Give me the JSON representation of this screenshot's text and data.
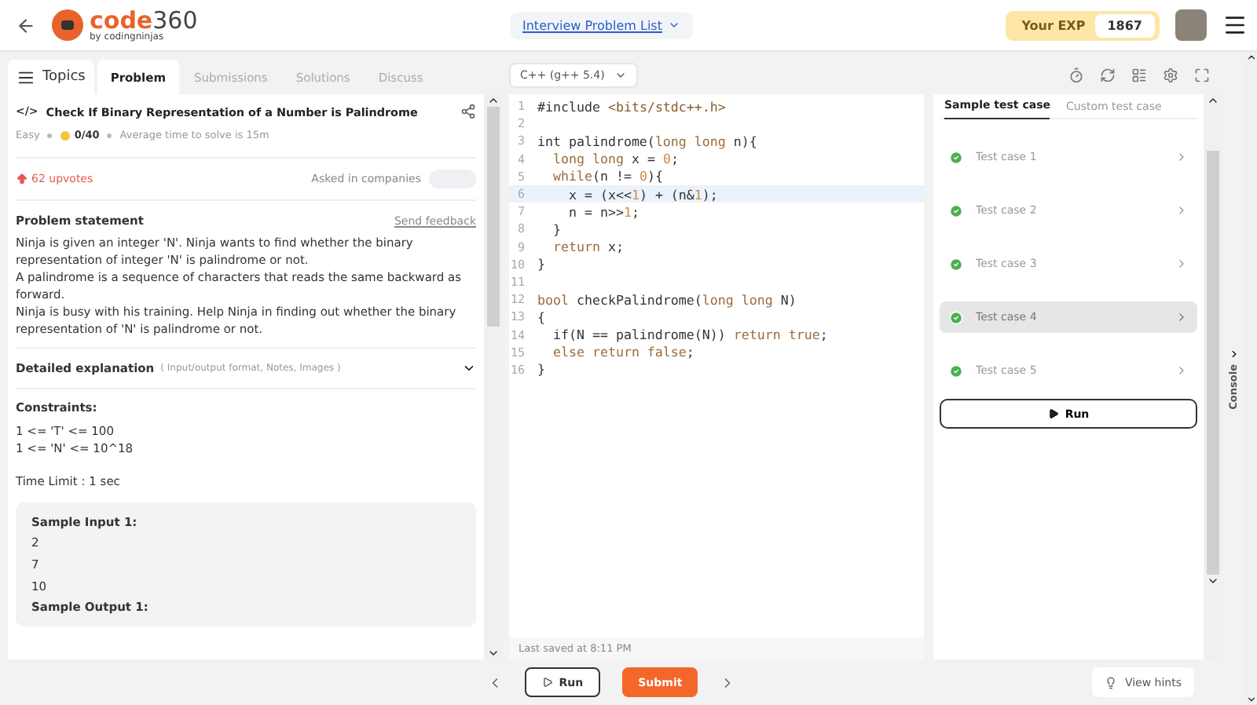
{
  "header": {
    "logo": {
      "name": "code",
      "number": "360",
      "byline": "by codingninjas"
    },
    "list_button": "Interview Problem List",
    "exp": {
      "label": "Your EXP",
      "value": "1867"
    }
  },
  "left_tabs": {
    "topics": "Topics",
    "tabs": [
      {
        "label": "Problem",
        "selected": true
      },
      {
        "label": "Submissions",
        "selected": false
      },
      {
        "label": "Solutions",
        "selected": false
      },
      {
        "label": "Discuss",
        "selected": false
      }
    ]
  },
  "problem": {
    "icon": "</>",
    "title": "Check If Binary Representation of a Number is Palindrome",
    "difficulty": "Easy",
    "score": "0/40",
    "avg_time": "Average time to solve is 15m",
    "upvotes": "62 upvotes",
    "asked_in": "Asked in companies",
    "statement_heading": "Problem statement",
    "feedback": "Send feedback",
    "statement": [
      "Ninja is given an integer 'N'. Ninja wants to find whether the binary representation of integer 'N' is palindrome or not.",
      "A palindrome is a sequence of characters that reads the same backward as forward.",
      "Ninja is busy with his training. Help Ninja in finding out whether the binary representation of 'N' is palindrome or not."
    ],
    "explanation": {
      "title": "Detailed explanation",
      "hint": "( Input/output format, Notes, Images )",
      "expanded": false
    },
    "constraints_heading": "Constraints:",
    "constraints": [
      "1 <= 'T' <= 100",
      "1 <= 'N' <= 10^18"
    ],
    "time_limit": "Time Limit :  1 sec",
    "sample_input": {
      "title": "Sample Input 1:",
      "lines": [
        "2",
        "7",
        "10"
      ]
    },
    "sample_output": {
      "title": "Sample Output 1:"
    }
  },
  "editor": {
    "language": "C++ (g++ 5.4)",
    "lines": [
      {
        "number": "1",
        "highlighted": false,
        "tokens": [
          {
            "kind": "text",
            "text": "#include "
          },
          {
            "kind": "string",
            "text": "<bits/stdc++.h>"
          }
        ]
      },
      {
        "number": "2",
        "highlighted": false
      },
      {
        "number": "3",
        "highlighted": false,
        "tokens": [
          {
            "kind": "text",
            "text": "int palindrome("
          },
          {
            "kind": "keyword",
            "text": "long long"
          },
          {
            "kind": "text",
            "text": " n){"
          }
        ]
      },
      {
        "number": "4",
        "highlighted": false,
        "tokens": [
          {
            "kind": "keyword",
            "text": "  long long"
          },
          {
            "kind": "text",
            "text": " x = "
          },
          {
            "kind": "number",
            "text": "0"
          },
          {
            "kind": "text",
            "text": ";"
          }
        ]
      },
      {
        "number": "5",
        "highlighted": false,
        "tokens": [
          {
            "kind": "keyword",
            "text": "  while"
          },
          {
            "kind": "text",
            "text": "(n != "
          },
          {
            "kind": "number",
            "text": "0"
          },
          {
            "kind": "text",
            "text": "){"
          }
        ]
      },
      {
        "number": "6",
        "highlighted": true,
        "tokens": [
          {
            "kind": "text",
            "text": "    x = (x<<"
          },
          {
            "kind": "number",
            "text": "1"
          },
          {
            "kind": "text",
            "text": ") + (n&"
          },
          {
            "kind": "number",
            "text": "1"
          },
          {
            "kind": "text",
            "text": ");"
          }
        ]
      },
      {
        "number": "7",
        "highlighted": false,
        "tokens": [
          {
            "kind": "text",
            "text": "    n = n>>"
          },
          {
            "kind": "number",
            "text": "1"
          },
          {
            "kind": "text",
            "text": ";"
          }
        ]
      },
      {
        "number": "8",
        "highlighted": false,
        "tokens": [
          {
            "kind": "text",
            "text": "  }"
          }
        ]
      },
      {
        "number": "9",
        "highlighted": false,
        "tokens": [
          {
            "kind": "keyword",
            "text": "  return"
          },
          {
            "kind": "text",
            "text": " x;"
          }
        ]
      },
      {
        "number": "10",
        "highlighted": false,
        "tokens": [
          {
            "kind": "text",
            "text": "}"
          }
        ]
      },
      {
        "number": "11",
        "highlighted": false
      },
      {
        "number": "12",
        "highlighted": false,
        "tokens": [
          {
            "kind": "keyword",
            "text": "bool"
          },
          {
            "kind": "text",
            "text": " checkPalindrome("
          },
          {
            "kind": "keyword",
            "text": "long long"
          },
          {
            "kind": "text",
            "text": " N)"
          }
        ]
      },
      {
        "number": "13",
        "highlighted": false,
        "tokens": [
          {
            "kind": "text",
            "text": "{"
          }
        ]
      },
      {
        "number": "14",
        "highlighted": false,
        "tokens": [
          {
            "kind": "text",
            "text": "  if(N == palindrome(N)) "
          },
          {
            "kind": "keyword",
            "text": "return true"
          },
          {
            "kind": "text",
            "text": ";"
          }
        ]
      },
      {
        "number": "15",
        "highlighted": false,
        "tokens": [
          {
            "kind": "keyword",
            "text": "  else return false"
          },
          {
            "kind": "text",
            "text": ";"
          }
        ]
      },
      {
        "number": "16",
        "highlighted": false,
        "tokens": [
          {
            "kind": "text",
            "text": "}"
          }
        ]
      }
    ],
    "saved": "Last saved at 8:11 PM"
  },
  "tests": {
    "tabs": [
      {
        "label": "Sample test case",
        "selected": true
      },
      {
        "label": "Custom test case",
        "selected": false
      }
    ],
    "cases": [
      {
        "label": "Test case 1",
        "passed": true,
        "selected": false
      },
      {
        "label": "Test case 2",
        "passed": true,
        "selected": false
      },
      {
        "label": "Test case 3",
        "passed": true,
        "selected": false
      },
      {
        "label": "Test case 4",
        "passed": true,
        "selected": true
      },
      {
        "label": "Test case 5",
        "passed": true,
        "selected": false
      }
    ],
    "run": "Run"
  },
  "console": "Console",
  "bottom": {
    "run": "Run",
    "submit": "Submit",
    "hints": "View hints"
  }
}
